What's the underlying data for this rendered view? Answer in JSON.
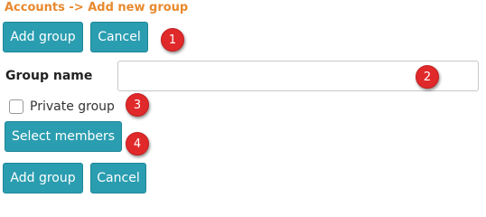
{
  "breadcrumb": "Accounts -> Add new group",
  "top_actions": {
    "add_label": "Add group",
    "cancel_label": "Cancel"
  },
  "form": {
    "group_name_label": "Group name",
    "group_name_value": "",
    "private_label": "Private group",
    "private_checked": false,
    "select_members_label": "Select members"
  },
  "bottom_actions": {
    "add_label": "Add group",
    "cancel_label": "Cancel"
  },
  "markers": [
    "1",
    "2",
    "3",
    "4"
  ],
  "colors": {
    "accent": "#2a9db0",
    "breadcrumb": "#e8892e",
    "marker": "#e0292a"
  }
}
